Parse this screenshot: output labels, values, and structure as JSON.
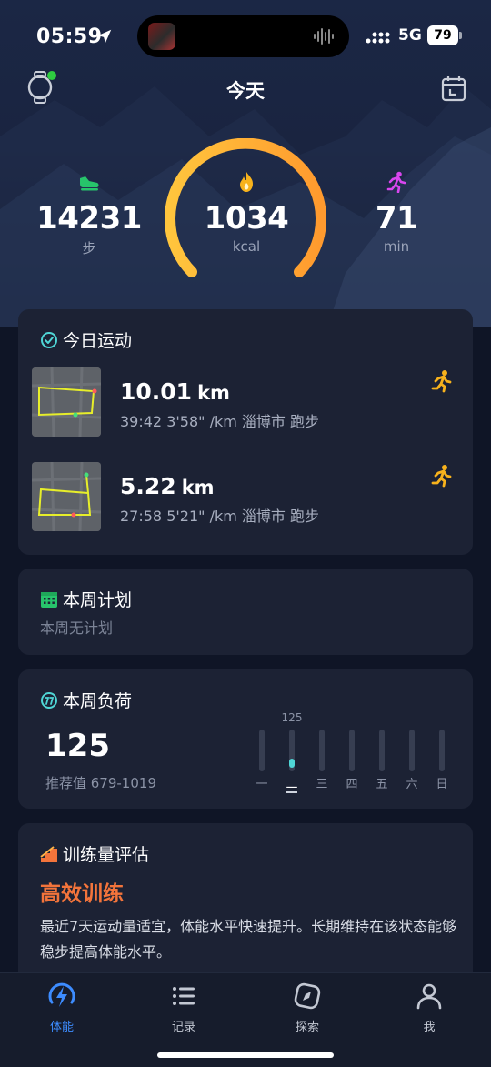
{
  "status_bar": {
    "time": "05:59",
    "network": "5G",
    "battery": "79"
  },
  "header": {
    "title": "今天"
  },
  "stats": {
    "steps": {
      "value": "14231",
      "unit": "步",
      "icon": "shoe-icon",
      "color": "#27c46b"
    },
    "calories": {
      "value": "1034",
      "unit": "kcal",
      "icon": "flame-icon",
      "color": "#f7b21c"
    },
    "minutes": {
      "value": "71",
      "unit": "min",
      "icon": "running-person-icon",
      "color": "#d946ef"
    }
  },
  "today_sport": {
    "title": "今日运动",
    "activities": [
      {
        "distance": "10.01",
        "unit": "km",
        "meta": "39:42  3'58\" /km 淄博市 跑步"
      },
      {
        "distance": "5.22",
        "unit": "km",
        "meta": "27:58  5'21\" /km 淄博市 跑步"
      }
    ]
  },
  "weekly_plan": {
    "title": "本周计划",
    "subtitle": "本周无计划"
  },
  "weekly_load": {
    "title": "本周负荷",
    "value": "125",
    "recommended": "推荐值 679-1019",
    "days": [
      {
        "label": "一",
        "value": 0
      },
      {
        "label": "二",
        "value": 125,
        "value_label": "125",
        "current": true
      },
      {
        "label": "三",
        "value": 0
      },
      {
        "label": "四",
        "value": 0
      },
      {
        "label": "五",
        "value": 0
      },
      {
        "label": "六",
        "value": 0
      },
      {
        "label": "日",
        "value": 0
      }
    ]
  },
  "training": {
    "title": "训练量评估",
    "level": "高效训练",
    "description": "最近7天运动量适宜，体能水平快速提升。长期维持在该状态能够稳步提高体能水平。"
  },
  "tabs": [
    {
      "label": "体能",
      "icon": "lightning-circle-icon",
      "active": true
    },
    {
      "label": "记录",
      "icon": "list-icon",
      "active": false
    },
    {
      "label": "探索",
      "icon": "compass-icon",
      "active": false
    },
    {
      "label": "我",
      "icon": "person-icon",
      "active": false
    }
  ],
  "colors": {
    "accent": "#3d8cff",
    "gauge_start": "#ffc53d",
    "gauge_end": "#ff9a2e",
    "training_level": "#f3743b",
    "load_bar": "#4fd6d6"
  }
}
